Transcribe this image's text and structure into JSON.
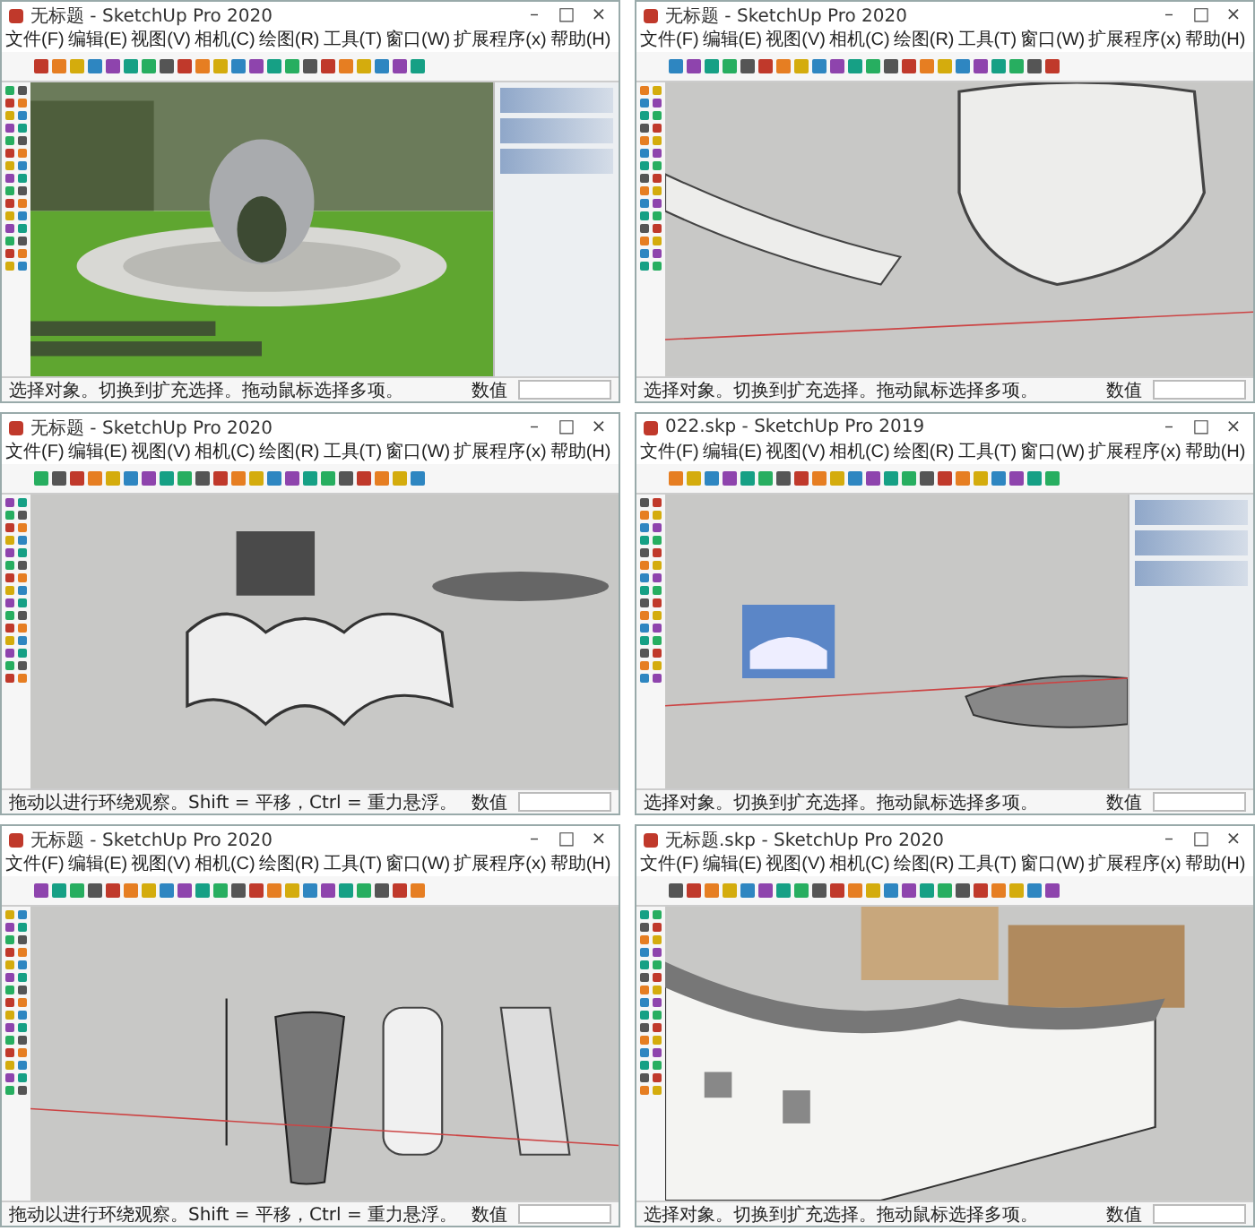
{
  "windows": [
    {
      "title": "无标题 - SketchUp Pro 2020",
      "controls": [
        "–",
        "□",
        "×"
      ],
      "menu": [
        "文件(F)",
        "编辑(E)",
        "视图(V)",
        "相机(C)",
        "绘图(R)",
        "工具(T)",
        "窗口(W)",
        "扩展程序(x)",
        "帮助(H)"
      ],
      "kind": "render",
      "tray": true,
      "status": "选择对象。切换到扩充选择。拖动鼠标选择多项。",
      "measure_label": "数值"
    },
    {
      "title": "无标题 - SketchUp Pro 2020",
      "controls": [
        "–",
        "□",
        "×"
      ],
      "menu": [
        "文件(F)",
        "编辑(E)",
        "视图(V)",
        "相机(C)",
        "绘图(R)",
        "工具(T)",
        "窗口(W)",
        "扩展程序(x)",
        "帮助(H)"
      ],
      "kind": "bench",
      "tray": false,
      "status": "选择对象。切换到扩充选择。拖动鼠标选择多项。",
      "measure_label": "数值"
    },
    {
      "title": "无标题 - SketchUp Pro 2020",
      "controls": [
        "–",
        "□",
        "×"
      ],
      "menu": [
        "文件(F)",
        "编辑(E)",
        "视图(V)",
        "相机(C)",
        "绘图(R)",
        "工具(T)",
        "窗口(W)",
        "扩展程序(x)",
        "帮助(H)"
      ],
      "kind": "wave",
      "tray": false,
      "status": "拖动以进行环绕观察。Shift = 平移，Ctrl = 重力悬浮。",
      "measure_label": "数值"
    },
    {
      "title": "022.skp - SketchUp Pro 2019",
      "controls": [
        "–",
        "□",
        "×"
      ],
      "menu": [
        "文件(F)",
        "编辑(E)",
        "视图(V)",
        "相机(C)",
        "绘图(R)",
        "工具(T)",
        "窗口(W)",
        "扩展程序(x)",
        "帮助(H)"
      ],
      "kind": "roof",
      "tray": true,
      "status": "选择对象。切换到扩充选择。拖动鼠标选择多项。",
      "measure_label": "数值"
    },
    {
      "title": "无标题 - SketchUp Pro 2020",
      "controls": [
        "–",
        "□",
        "×"
      ],
      "menu": [
        "文件(F)",
        "编辑(E)",
        "视图(V)",
        "相机(C)",
        "绘图(R)",
        "工具(T)",
        "窗口(W)",
        "扩展程序(x)",
        "帮助(H)"
      ],
      "kind": "towers",
      "tray": false,
      "status": "拖动以进行环绕观察。Shift = 平移，Ctrl = 重力悬浮。",
      "measure_label": "数值"
    },
    {
      "title": "无标题.skp - SketchUp Pro 2020",
      "controls": [
        "–",
        "□",
        "×"
      ],
      "menu": [
        "文件(F)",
        "编辑(E)",
        "视图(V)",
        "相机(C)",
        "绘图(R)",
        "工具(T)",
        "窗口(W)",
        "扩展程序(x)",
        "帮助(H)"
      ],
      "kind": "house",
      "tray": false,
      "status": "选择对象。切换到扩充选择。拖动鼠标选择多项。",
      "measure_label": "数值"
    }
  ]
}
